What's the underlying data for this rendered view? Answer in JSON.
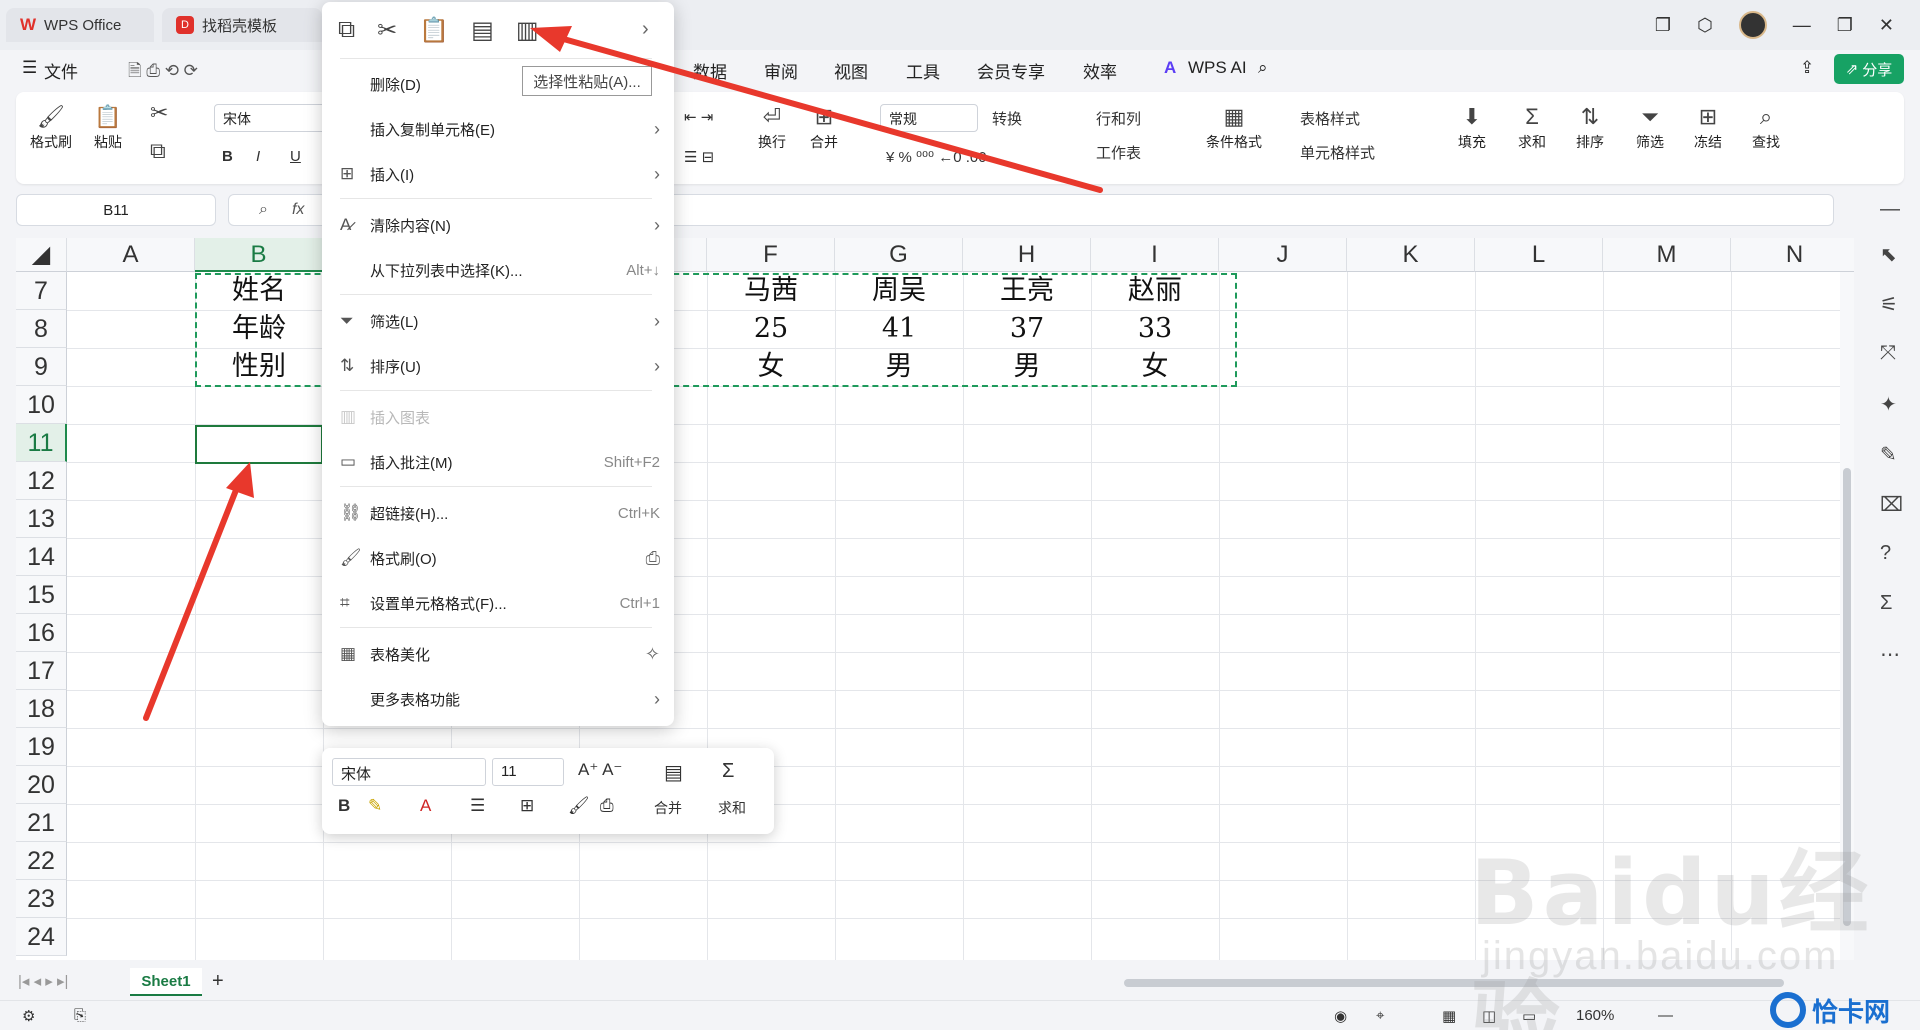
{
  "tabs": [
    {
      "label": "WPS Office"
    },
    {
      "label": "找稻壳模板"
    }
  ],
  "menu": {
    "file": "文件",
    "items": [
      "数据",
      "审阅",
      "视图",
      "工具",
      "会员专享",
      "效率"
    ],
    "wps_ai": "WPS AI",
    "share": "分享"
  },
  "ribbon": {
    "format_painter": "格式刷",
    "paste": "粘贴",
    "font": "宋体",
    "bold": "B",
    "italic": "I",
    "underline": "U",
    "wrap": "换行",
    "merge": "合并",
    "number_format": "常规",
    "convert": "转换",
    "row_col": "行和列",
    "worksheet": "工作表",
    "cond_format": "条件格式",
    "table_style": "表格样式",
    "cell_style": "单元格样式",
    "fill": "填充",
    "sum": "求和",
    "sort": "排序",
    "filter": "筛选",
    "freeze": "冻结",
    "find": "查找"
  },
  "namebox": "B11",
  "fx": "fx",
  "columns": [
    "A",
    "B",
    "C",
    "D",
    "E",
    "F",
    "G",
    "H",
    "I",
    "J",
    "K",
    "L",
    "M",
    "N"
  ],
  "rows": [
    "7",
    "8",
    "9",
    "10",
    "11",
    "12",
    "13",
    "14",
    "15",
    "16",
    "17",
    "18",
    "19",
    "20",
    "21",
    "22",
    "23",
    "24"
  ],
  "cells": {
    "b7": "姓名",
    "f7": "马茜",
    "g7": "周吴",
    "h7": "王亮",
    "i7": "赵丽",
    "b8": "年龄",
    "f8": "25",
    "g8": "41",
    "h8": "37",
    "i8": "33",
    "b9": "性别",
    "f9": "女",
    "g9": "男",
    "h9": "男",
    "i9": "女"
  },
  "context_menu": {
    "delete": "删除(D)",
    "paste_special_tip": "选择性粘贴(A)...",
    "insert_copied": "插入复制单元格(E)",
    "insert": "插入(I)",
    "clear": "清除内容(N)",
    "pick_list": "从下拉列表中选择(K)...",
    "pick_list_sc": "Alt+↓",
    "filter": "筛选(L)",
    "sort": "排序(U)",
    "insert_chart": "插入图表",
    "insert_comment": "插入批注(M)",
    "insert_comment_sc": "Shift+F2",
    "hyperlink": "超链接(H)...",
    "hyperlink_sc": "Ctrl+K",
    "format_painter": "格式刷(O)",
    "format_cells": "设置单元格格式(F)...",
    "format_cells_sc": "Ctrl+1",
    "beautify": "表格美化",
    "more": "更多表格功能"
  },
  "mini_toolbar": {
    "font": "宋体",
    "size": "11",
    "merge": "合并",
    "sum": "求和"
  },
  "sheet_tab": "Sheet1",
  "zoom": "160%",
  "watermark": "Baidu经验",
  "watermark_url": "jingyan.baidu.com",
  "badge": "恰卡网",
  "colors": {
    "accent": "#1e8a4c",
    "arrow": "#e8382c",
    "share": "#17a264"
  }
}
